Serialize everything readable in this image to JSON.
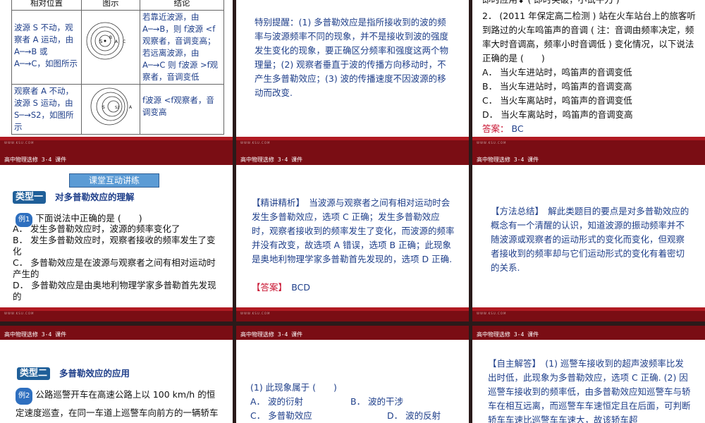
{
  "footer_title": "高中物理选修 3-4 课件",
  "footer_small": "WWW.KSU.COM",
  "s1": {
    "headers": [
      "相对位置",
      "图示",
      "结论"
    ],
    "row1_left": "波源 S 不动，观察者 A 运动，由 A─→B 或 A─→C，如图所示",
    "row1_right": "若靠近波源，由 A─→B，则 f波源 <f观察者，音调变高；若远离波源，由 A─→C 则 f波源 >f观察者，音调变低",
    "row2_left": "观察者 A 不动，波源 S 运动，由 S─→S2，如图所示",
    "row2_right": "f波源 <f观察者，音调变高",
    "fig1_labels": [
      "S",
      "B",
      "A",
      "C"
    ],
    "fig2_labels": [
      "S",
      "S2",
      "A"
    ]
  },
  "s2": {
    "text": "特别提醒：(1) 多普勒效应是指所接收到的波的频率与波源频率不同的现象，并不是接收到波的强度发生变化的现象，要正确区分频率和强度这两个物理量；(2) 观察者垂直于波的传播方向移动时，不产生多普勒效应；(3) 波的传播速度不因波源的移动而改变."
  },
  "s3": {
    "top": "即时应用⬇ ( 即时突破，小试牛刀 )",
    "q": "2． (2011 年保定高二检测 ) 站在火车站台上的旅客听到路过的火车鸣笛声的音调 ( 注：音调由频率决定，频率大时音调高，频率小时音调低 ) 变化情况，以下说法正确的是 (　　)",
    "options": [
      "A． 当火车进站时，鸣笛声的音调变低",
      "B． 当火车进站时，鸣笛声的音调变高",
      "C． 当火车离站时，鸣笛声的音调变低",
      "D． 当火车离站时，鸣笛声的音调变高"
    ],
    "answer_label": "答案：",
    "answer": "BC"
  },
  "s4": {
    "banner": "课堂互动讲练",
    "type_label": "类型一",
    "type_title": "对多普勒效应的理解",
    "example": "例1",
    "q": "下面说法中正确的是 (　　)",
    "options": [
      "A． 发生多普勒效应时，波源的频率变化了",
      "B． 发生多普勒效应时，观察者接收的频率发生了变化",
      "C． 多普勒效应是在波源与观察者之间有相对运动时产生的",
      "D． 多普勒效应是由奥地利物理学家多普勒首先发现的"
    ]
  },
  "s5": {
    "text": "【精讲精析】　当波源与观察者之间有相对运动时会发生多普勒效应，选项 C 正确；发生多普勒效应时，观察者接收到的频率发生了变化，而波源的频率并没有改变，故选项 A 错误，选项 B 正确；此现象是奥地利物理学家多普勒首先发现的，选项 D 正确.",
    "answer_label": "【答案】",
    "answer": "BCD"
  },
  "s6": {
    "text": "【方法总结】　解此类题目的要点是对多普勒效应的概念有一个清醒的认识，知道波源的振动频率并不随波源或观察者的运动形式的变化而变化，但观察者接收到的频率却与它们运动形式的变化有着密切的关系."
  },
  "s7": {
    "type_label": "类型二",
    "type_title": "多普勒效应的应用",
    "example": "例2",
    "text": "公路巡警开车在高速公路上以 100 km/h 的恒定速度巡查，在同一车道上巡警车向前方的一辆轿车发出一个已知频率的超声波，若该超声波被"
  },
  "s8": {
    "q": "(1) 此现象属于 (　　)",
    "options": [
      "A． 波的衍射",
      "B． 波的干涉",
      "C． 多普勒效应",
      "D． 波的反射"
    ]
  },
  "s9": {
    "text": "【自主解答】　(1) 巡警车接收到的超声波频率比发出时低，此现象为多普勒效应，选项 C 正确. (2) 因巡警车接收到的频率低，由多普勒效应知巡警车与轿车在相互远离，而巡警车车速恒定且在后面，可判断轿车车速比巡警车车速大，故该轿车超"
  }
}
